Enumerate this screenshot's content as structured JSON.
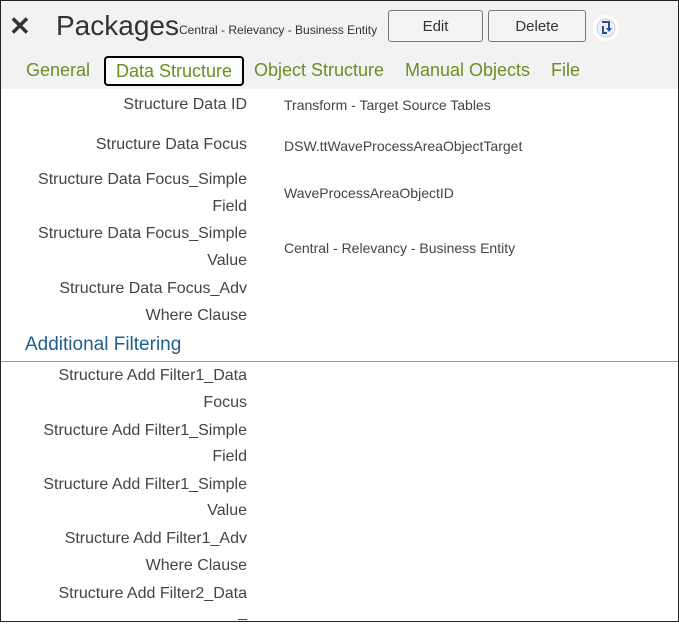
{
  "header": {
    "title": "Packages",
    "subtitle": "Central - Relevancy - Business Entity",
    "edit_label": "Edit",
    "delete_label": "Delete"
  },
  "tabs": [
    {
      "label": "General",
      "active": false
    },
    {
      "label": "Data Structure",
      "active": true
    },
    {
      "label": "Object Structure",
      "active": false
    },
    {
      "label": "Manual Objects",
      "active": false
    },
    {
      "label": "File",
      "active": false
    }
  ],
  "fields": [
    {
      "label_lines": [
        "Structure Data ID"
      ],
      "value": "Transform - Target Source Tables"
    },
    {
      "label_lines": [
        "Structure Data Focus"
      ],
      "value": "DSW.ttWaveProcessAreaObjectTarget"
    },
    {
      "label_lines": [
        "Structure Data Focus_Simple",
        "Field"
      ],
      "value": "WaveProcessAreaObjectID"
    },
    {
      "label_lines": [
        "Structure Data Focus_Simple",
        "Value"
      ],
      "value": "Central - Relevancy - Business Entity"
    },
    {
      "label_lines": [
        "Structure Data Focus_Adv",
        "Where Clause"
      ],
      "value": ""
    }
  ],
  "section": {
    "title": "Additional Filtering"
  },
  "filter_fields": [
    {
      "label_lines": [
        "Structure Add Filter1_Data",
        "Focus"
      ]
    },
    {
      "label_lines": [
        "Structure Add Filter1_Simple",
        "Field"
      ]
    },
    {
      "label_lines": [
        "Structure Add Filter1_Simple",
        "Value"
      ]
    },
    {
      "label_lines": [
        "Structure Add Filter1_Adv",
        "Where Clause"
      ]
    },
    {
      "label_lines": [
        "Structure Add Filter2_Data",
        "_"
      ]
    }
  ],
  "colors": {
    "accent": "#6b8e23",
    "section": "#1f5f8b"
  }
}
